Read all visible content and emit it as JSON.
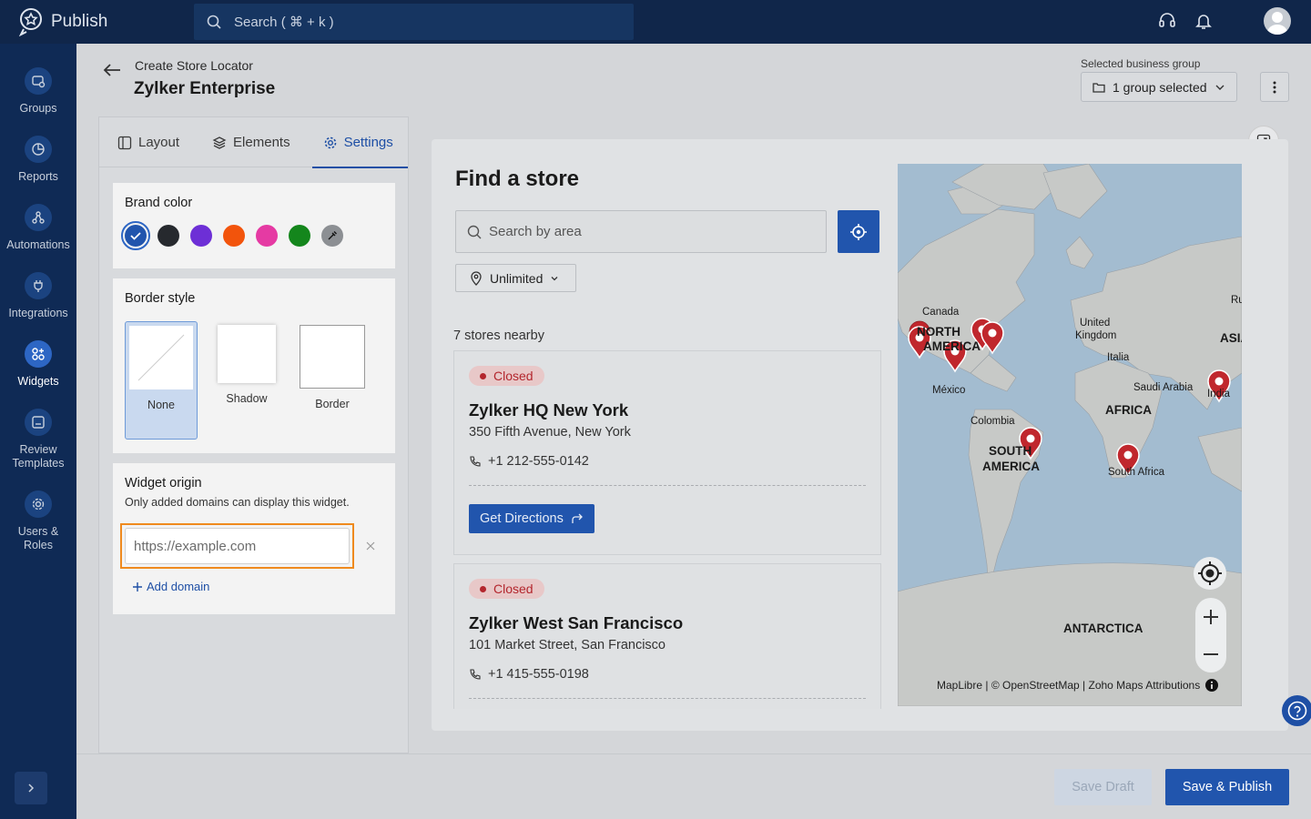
{
  "app": {
    "name": "Publish"
  },
  "search": {
    "placeholder": "Search ( ⌘ + k )"
  },
  "sidebar": {
    "items": [
      {
        "label": "Groups"
      },
      {
        "label": "Reports"
      },
      {
        "label": "Automations"
      },
      {
        "label": "Integrations"
      },
      {
        "label": "Widgets"
      },
      {
        "label": "Review Templates"
      },
      {
        "label": "Users & Roles"
      }
    ]
  },
  "header": {
    "subtitle": "Create Store Locator",
    "title": "Zylker Enterprise",
    "business_group_label": "Selected business group",
    "business_group_value": "1 group selected"
  },
  "tabs": [
    {
      "label": "Layout"
    },
    {
      "label": "Elements"
    },
    {
      "label": "Settings"
    }
  ],
  "settings": {
    "brand_color": {
      "title": "Brand color",
      "colors": [
        "#2155ad",
        "#26292e",
        "#6d2fd6",
        "#f2540c",
        "#e53aa3",
        "#14861c"
      ]
    },
    "border_style": {
      "title": "Border style",
      "options": [
        {
          "label": "None"
        },
        {
          "label": "Shadow"
        },
        {
          "label": "Border"
        }
      ],
      "selected": "None"
    },
    "widget_origin": {
      "title": "Widget origin",
      "desc": "Only added domains can display this widget.",
      "placeholder": "https://example.com",
      "add_label": "Add domain"
    }
  },
  "preview": {
    "title": "Find a store",
    "search_placeholder": "Search by area",
    "radius": "Unlimited",
    "nearby": "7 stores nearby",
    "stores": [
      {
        "status": "Closed",
        "name": "Zylker HQ New York",
        "address": "350 Fifth Avenue, New York",
        "phone": "+1 212-555-0142",
        "directions": "Get Directions"
      },
      {
        "status": "Closed",
        "name": "Zylker West San Francisco",
        "address": "101 Market Street, San Francisco",
        "phone": "+1 415-555-0198"
      }
    ],
    "map": {
      "labels": [
        "Canada",
        "NORTH",
        "AMERICA",
        "México",
        "Colombia",
        "SOUTH",
        "AMERICA",
        "United",
        "Kingdom",
        "Italia",
        "Saudi Arabia",
        "AFRICA",
        "South Africa",
        "ASIA",
        "Ru",
        "India",
        "ANTARCTICA"
      ],
      "attribution": "MapLibre | © OpenStreetMap | Zoho Maps Attributions"
    }
  },
  "footer": {
    "save_draft": "Save Draft",
    "save_publish": "Save & Publish"
  }
}
